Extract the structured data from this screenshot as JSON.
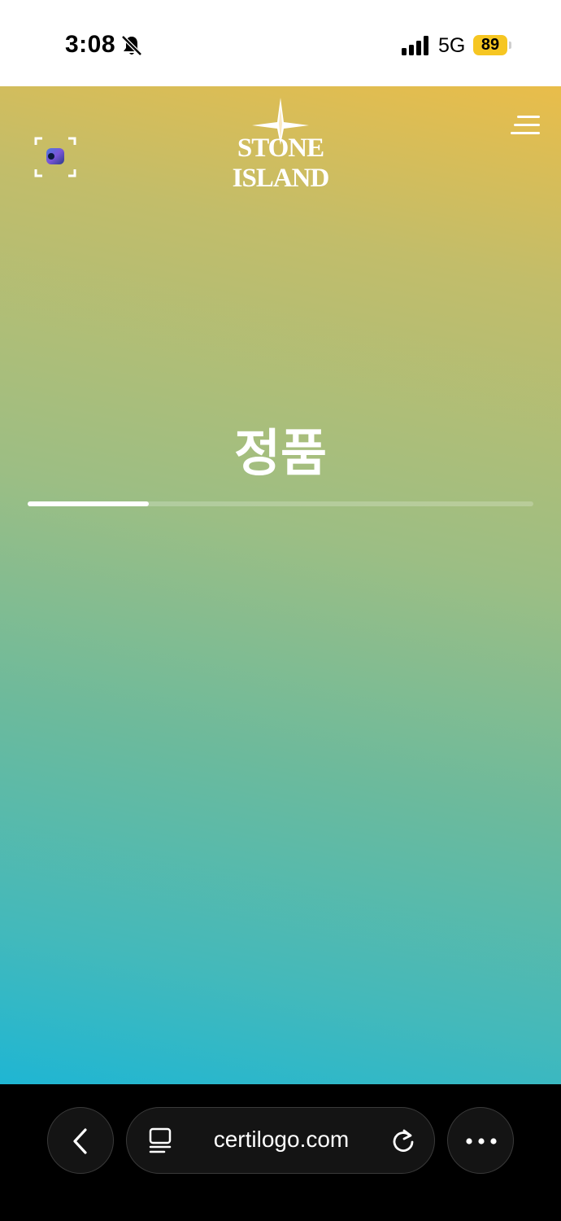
{
  "status_bar": {
    "time": "3:08",
    "network": "5G",
    "battery_level": "89",
    "battery_color": "#f6c622",
    "icons": [
      "bell-slash-icon",
      "cellular-signal-icon",
      "battery-icon"
    ]
  },
  "header": {
    "brand_left": "STONE",
    "brand_right": "ISLAND",
    "icons": [
      "scan-icon",
      "compass-star-icon",
      "hamburger-menu-icon"
    ]
  },
  "result": {
    "text": "정품",
    "progress_percent": 24
  },
  "browser": {
    "url": "certilogo.com",
    "icons": [
      "chevron-left-icon",
      "page-icon",
      "reload-icon",
      "more-icon"
    ]
  },
  "colors": {
    "gradient_top": "#e9bd4a",
    "gradient_middle": "#9cbe84",
    "gradient_bottom": "#1fb6d3"
  }
}
